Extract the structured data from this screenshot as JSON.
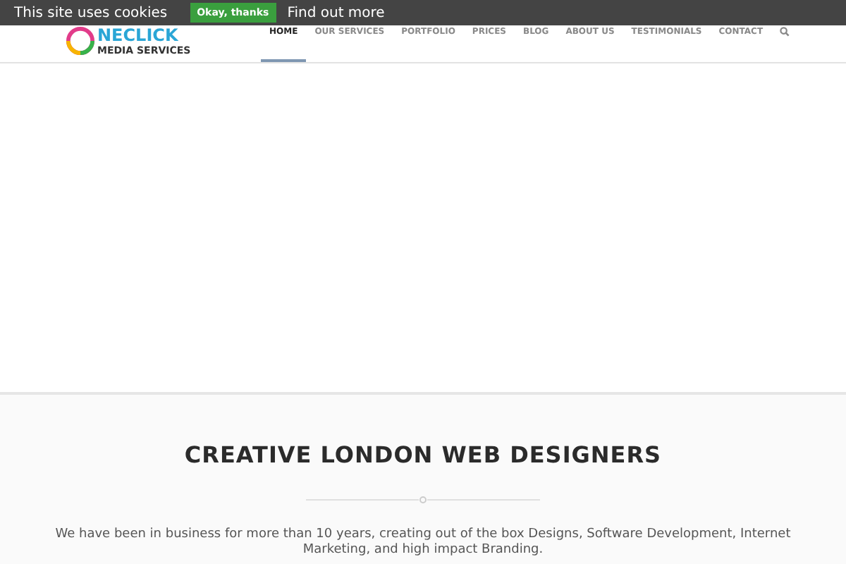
{
  "cookie_bar": {
    "message": "This site uses cookies",
    "accept": "Okay, thanks",
    "link": "Find out more"
  },
  "logo": {
    "wordmark": "NECLICK",
    "tagline": "MEDIA SERVICES"
  },
  "nav": [
    {
      "label": "HOME",
      "selected": true
    },
    {
      "label": "OUR SERVICES",
      "selected": false
    },
    {
      "label": "PORTFOLIO",
      "selected": false
    },
    {
      "label": "PRICES",
      "selected": false
    },
    {
      "label": "BLOG",
      "selected": false
    },
    {
      "label": "ABOUT US",
      "selected": false
    },
    {
      "label": "TESTIMONIALS",
      "selected": false
    },
    {
      "label": "CONTACT",
      "selected": false
    }
  ],
  "intro": {
    "heading": "CREATIVE LONDON WEB DESIGNERS",
    "text": "We have been in business for more than 10 years, creating out of the box Designs, Software Development, Internet Marketing, and high impact Branding."
  }
}
